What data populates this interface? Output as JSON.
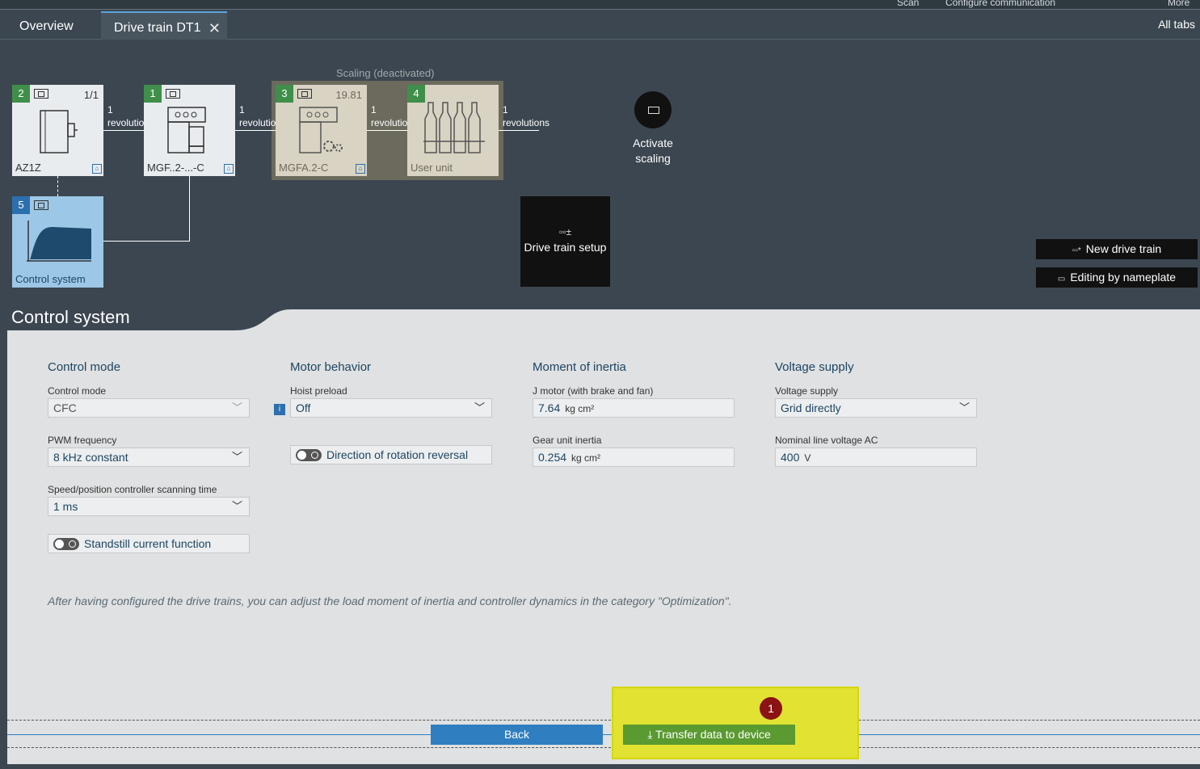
{
  "topbar": {
    "items": [
      "Scan",
      "Configure communication",
      "More"
    ]
  },
  "tabs": [
    {
      "label": "Overview"
    },
    {
      "label": "Drive train DT1",
      "close": "✕"
    }
  ],
  "alltabs": "All tabs",
  "scaling_title": "Scaling (deactivated)",
  "nodes": [
    {
      "num": "2",
      "ratio": "1/1",
      "label": "AZ1Z"
    },
    {
      "num": "1",
      "ratio": "",
      "label": "MGF..2-...-C"
    },
    {
      "num": "3",
      "ratio": "19.81",
      "label": "MGFA.2-C"
    },
    {
      "num": "4",
      "ratio": "",
      "label": "User unit"
    },
    {
      "num": "5",
      "ratio": "",
      "label": "Control system"
    }
  ],
  "connectors": [
    {
      "value": "1",
      "unit": "revolutions"
    },
    {
      "value": "1",
      "unit": "revolutions"
    },
    {
      "value": "1",
      "unit": "revolutions"
    },
    {
      "value": "1",
      "unit": "revolutions"
    }
  ],
  "activate": {
    "label": "Activate scaling"
  },
  "drive_train_setup": {
    "label": "Drive train setup"
  },
  "right_buttons": {
    "new_drive_train": "New drive train",
    "editing_by_nameplate": "Editing by nameplate"
  },
  "panel": {
    "title": "Control system",
    "control_mode": {
      "heading": "Control mode",
      "control_mode_label": "Control mode",
      "control_mode_value": "CFC",
      "pwm_label": "PWM frequency",
      "pwm_value": "8 kHz constant",
      "scan_label": "Speed/position controller scanning time",
      "scan_value": "1  ms",
      "standstill": "Standstill current function"
    },
    "motor_behavior": {
      "heading": "Motor behavior",
      "hoist_label": "Hoist preload",
      "hoist_value": "Off",
      "direction": "Direction of rotation reversal",
      "info": "i"
    },
    "inertia": {
      "heading": "Moment of inertia",
      "jmotor_label": "J motor (with brake and fan)",
      "jmotor_value": "7.64",
      "jmotor_unit": "kg cm²",
      "gear_label": "Gear unit inertia",
      "gear_value": "0.254",
      "gear_unit": "kg cm²"
    },
    "voltage": {
      "heading": "Voltage supply",
      "supply_label": "Voltage supply",
      "supply_value": "Grid directly",
      "nominal_label": "Nominal line voltage AC",
      "nominal_value": "400",
      "nominal_unit": "V"
    },
    "note": "After having configured the drive trains, you can adjust the load moment of inertia and controller dynamics in the category \"Optimization\"."
  },
  "footer": {
    "back": "Back",
    "transfer": "Transfer data to device",
    "badge": "1"
  }
}
